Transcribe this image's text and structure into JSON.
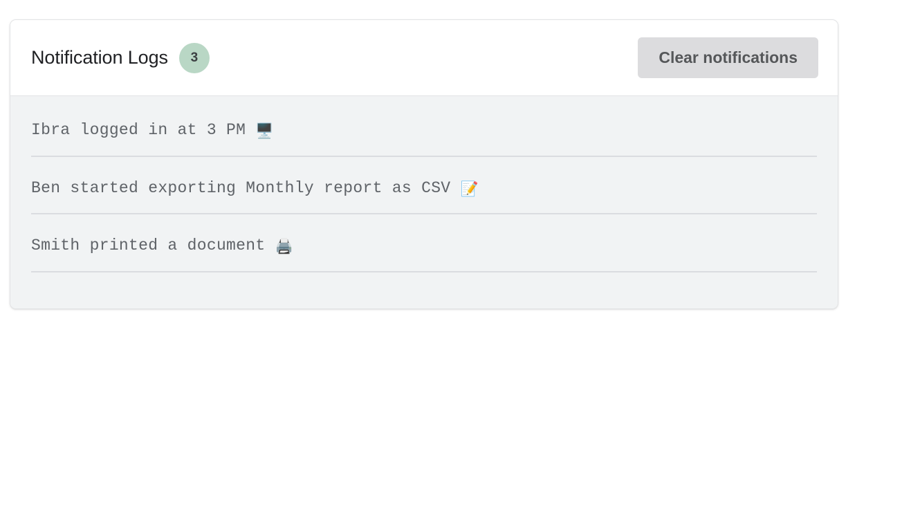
{
  "card": {
    "header": {
      "title": "Notification Logs",
      "badge_count": "3",
      "badge_color": "#b9d7c5",
      "clear_button_label": "Clear notifications",
      "clear_button_color": "#dcdcde"
    },
    "logs": [
      {
        "text": "Ibra logged in at 3 PM",
        "emoji": "🖥️",
        "emoji_name": "desktop-computer-icon"
      },
      {
        "text": "Ben started exporting Monthly report as CSV",
        "emoji": "📝",
        "emoji_name": "memo-icon"
      },
      {
        "text": "Smith printed a document",
        "emoji": "🖨️",
        "emoji_name": "printer-icon"
      }
    ]
  }
}
